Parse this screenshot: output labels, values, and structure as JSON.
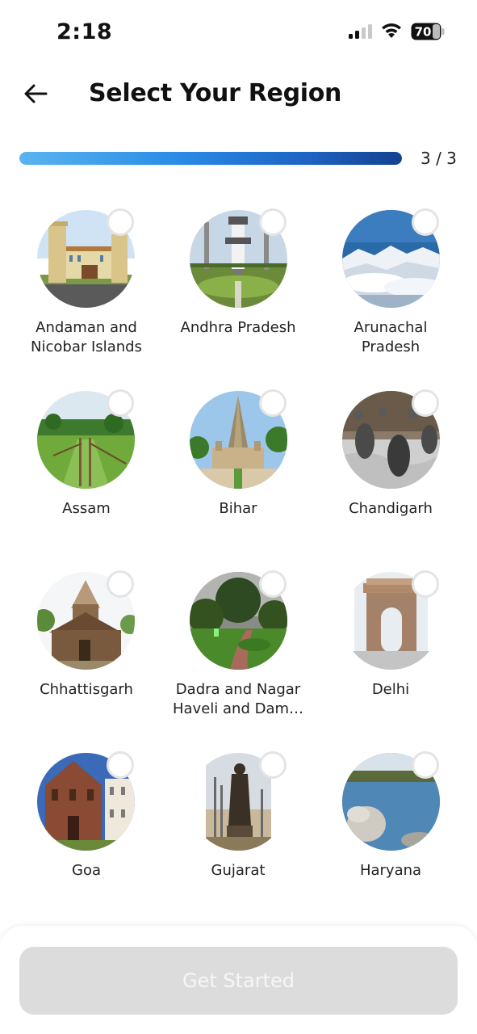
{
  "status_bar": {
    "time": "2:18",
    "battery": "70"
  },
  "header": {
    "title": "Select Your Region"
  },
  "progress": {
    "text": "3 / 3",
    "fraction": 1.0
  },
  "regions": [
    {
      "name": "Andaman and Nicobar Islands"
    },
    {
      "name": "Andhra Pradesh"
    },
    {
      "name": "Arunachal Pradesh"
    },
    {
      "name": "Assam"
    },
    {
      "name": "Bihar"
    },
    {
      "name": "Chandigarh"
    },
    {
      "name": "Chhattisgarh"
    },
    {
      "name": "Dadra and Nagar Haveli and Dam…"
    },
    {
      "name": "Delhi"
    },
    {
      "name": "Goa"
    },
    {
      "name": "Gujarat"
    },
    {
      "name": "Haryana"
    }
  ],
  "footer": {
    "cta_label": "Get Started"
  },
  "colors": {
    "progress_start": "#5ab4f0",
    "progress_end": "#13428f",
    "cta_disabled": "#dcdcdc"
  }
}
